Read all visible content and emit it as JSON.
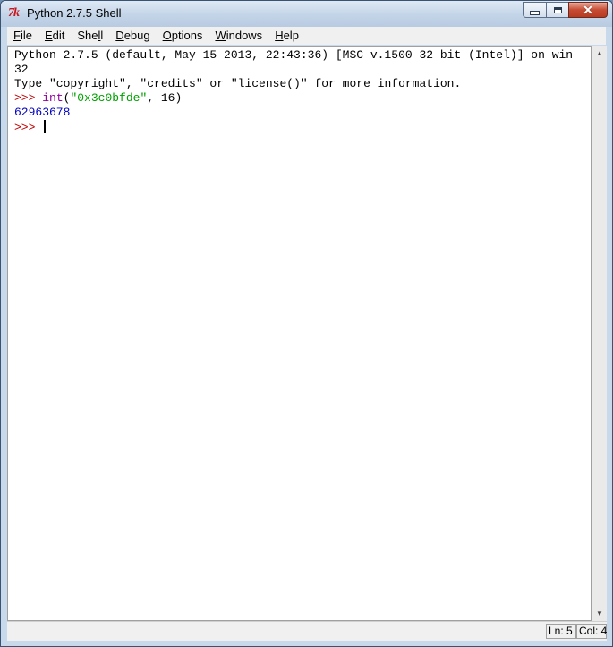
{
  "window": {
    "title": "Python 2.7.5 Shell",
    "app_icon_text": "7k"
  },
  "menubar": {
    "items": [
      {
        "ul": "F",
        "rest": "ile"
      },
      {
        "ul": "E",
        "rest": "dit"
      },
      {
        "pre": "She",
        "ul": "l",
        "rest": "l"
      },
      {
        "ul": "D",
        "rest": "ebug"
      },
      {
        "ul": "O",
        "rest": "ptions"
      },
      {
        "ul": "W",
        "rest": "indows"
      },
      {
        "ul": "H",
        "rest": "elp"
      }
    ]
  },
  "shell": {
    "banner_line1": "Python 2.7.5 (default, May 15 2013, 22:43:36) [MSC v.1500 32 bit (Intel)] on win",
    "banner_line2": "32",
    "banner_line3": "Type \"copyright\", \"credits\" or \"license()\" for more information.",
    "prompt": ">>> ",
    "input_builtin": "int",
    "input_paren_open": "(",
    "input_string": "\"0x3c0bfde\"",
    "input_rest": ", 16)",
    "output": "62963678",
    "prompt2": ">>> "
  },
  "statusbar": {
    "ln": "Ln: 5",
    "col": "Col: 4"
  },
  "colors": {
    "prompt": "#c00000",
    "builtin": "#9000a0",
    "string": "#00a000",
    "output": "#0000c0"
  }
}
